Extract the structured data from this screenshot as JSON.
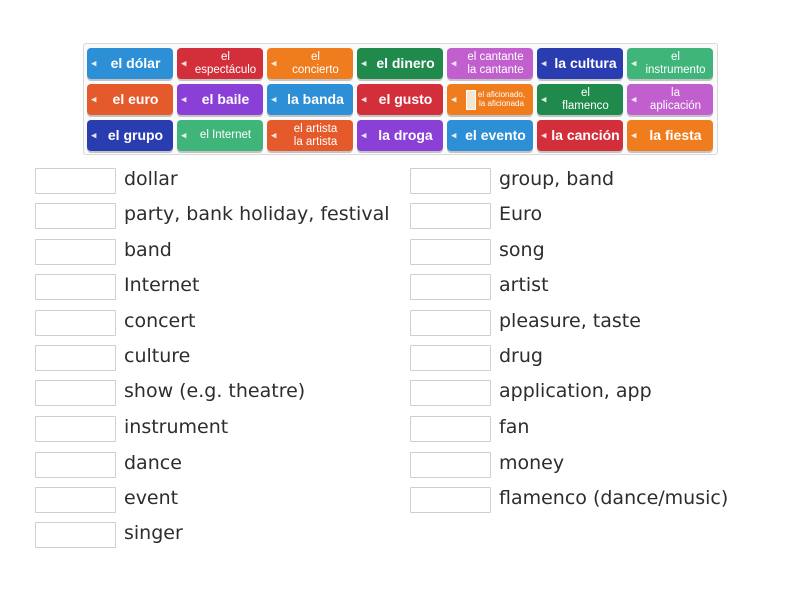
{
  "tiles": [
    {
      "line1": "el dólar",
      "line2": "",
      "color": "#2d8fd6",
      "size": "l"
    },
    {
      "line1": "el",
      "line2": "espectáculo",
      "color": "#d32f3a",
      "size": "m"
    },
    {
      "line1": "el",
      "line2": "concierto",
      "color": "#ef7d1e",
      "size": "m"
    },
    {
      "line1": "el dinero",
      "line2": "",
      "color": "#1f8a4c",
      "size": "l"
    },
    {
      "line1": "el cantante",
      "line2": "la cantante",
      "color": "#c15fcf",
      "size": "m"
    },
    {
      "line1": "la cultura",
      "line2": "",
      "color": "#2a3db0",
      "size": "l"
    },
    {
      "line1": "el",
      "line2": "instrumento",
      "color": "#3fb57a",
      "size": "m"
    },
    {
      "line1": "el euro",
      "line2": "",
      "color": "#e55a2b",
      "size": "l"
    },
    {
      "line1": "el baile",
      "line2": "",
      "color": "#8a3fd6",
      "size": "l"
    },
    {
      "line1": "la banda",
      "line2": "",
      "color": "#2d8fd6",
      "size": "l"
    },
    {
      "line1": "el gusto",
      "line2": "",
      "color": "#d32f3a",
      "size": "l"
    },
    {
      "line1": "el aficionado,",
      "line2": "la aficionada",
      "color": "#ef7d1e",
      "size": "s"
    },
    {
      "line1": "el",
      "line2": "flamenco",
      "color": "#1f8a4c",
      "size": "m"
    },
    {
      "line1": "la",
      "line2": "aplicación",
      "color": "#c15fcf",
      "size": "m"
    },
    {
      "line1": "el grupo",
      "line2": "",
      "color": "#2a3db0",
      "size": "l"
    },
    {
      "line1": "el Internet",
      "line2": "",
      "color": "#3fb57a",
      "size": "m"
    },
    {
      "line1": "el artista",
      "line2": "la artista",
      "color": "#e55a2b",
      "size": "m"
    },
    {
      "line1": "la droga",
      "line2": "",
      "color": "#8a3fd6",
      "size": "l"
    },
    {
      "line1": "el evento",
      "line2": "",
      "color": "#2d8fd6",
      "size": "l"
    },
    {
      "line1": "la canción",
      "line2": "",
      "color": "#d32f3a",
      "size": "l"
    },
    {
      "line1": "la fiesta",
      "line2": "",
      "color": "#ef7d1e",
      "size": "l"
    }
  ],
  "clues_left": [
    "dollar",
    "party, bank holiday, festival",
    "band",
    "Internet",
    "concert",
    "culture",
    "show (e.g. theatre)",
    "instrument",
    "dance",
    "event",
    "singer"
  ],
  "clues_right": [
    "group, band",
    "Euro",
    "song",
    "artist",
    "pleasure, taste",
    "drug",
    "application, app",
    "fan",
    "money",
    "flamenco (dance/music)"
  ],
  "icons": {
    "tile_audio": "speaker-icon",
    "tile_image": "image-thumbnail-icon"
  }
}
